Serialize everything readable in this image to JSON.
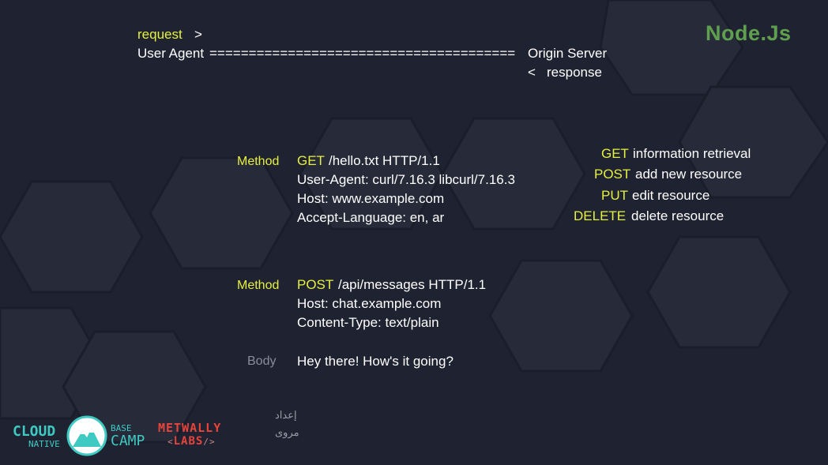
{
  "brand": {
    "title": "Node.Js",
    "accent": "#5fa04e",
    "yellow": "#e6f040"
  },
  "diagram": {
    "request_label": "request",
    "request_arrow": ">",
    "user_agent": "User Agent",
    "connector": "=======================================",
    "origin_server": "Origin Server",
    "response_arrow": "<",
    "response_label": "response"
  },
  "get_request": {
    "label": "Method",
    "method": "GET",
    "request_line": "/hello.txt HTTP/1.1",
    "headers": [
      "User-Agent: curl/7.16.3 libcurl/7.16.3",
      "Host: www.example.com",
      "Accept-Language: en, ar"
    ]
  },
  "post_request": {
    "label": "Method",
    "method": "POST",
    "request_line": "/api/messages HTTP/1.1",
    "headers": [
      "Host: chat.example.com",
      "Content-Type: text/plain"
    ],
    "body_label": "Body",
    "body": "Hey there! How's it going?"
  },
  "methods": [
    {
      "name": "GET",
      "desc": "information retrieval"
    },
    {
      "name": "POST",
      "desc": "add new resource"
    },
    {
      "name": "PUT",
      "desc": "edit resource"
    },
    {
      "name": "DELETE",
      "desc": "delete resource"
    }
  ],
  "logos": {
    "cloud_native": "CLOUD",
    "cloud_native_sub": "NATIVE",
    "base": "BASE",
    "camp": "CAMP",
    "metwally": "METWALLY",
    "labs": "LABS",
    "labs_left": "<",
    "labs_right": "/>",
    "signature_1": "إعداد",
    "signature_2": "مروى"
  }
}
